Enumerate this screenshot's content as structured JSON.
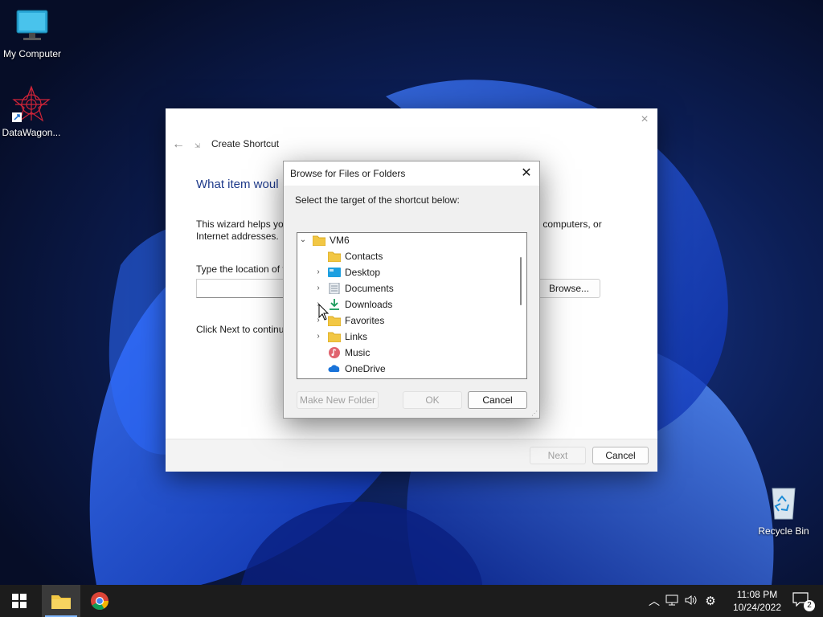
{
  "desktop": {
    "icons": [
      {
        "label": "My Computer"
      },
      {
        "label": "DataWagon..."
      },
      {
        "label": "Recycle Bin"
      }
    ]
  },
  "wizard": {
    "title": "Create Shortcut",
    "heading": "What item woul",
    "desc_line1_left": "This wizard helps you",
    "desc_line1_right": "ers, computers, or",
    "desc_line2": "Internet addresses.",
    "location_label": "Type the location of t",
    "browse_label": "Browse...",
    "next_hint": "Click Next to continu",
    "next_label": "Next",
    "cancel_label": "Cancel",
    "close_icon": "×"
  },
  "browse_dialog": {
    "title": "Browse for Files or Folders",
    "prompt": "Select the target of the shortcut below:",
    "tree": [
      {
        "label": "VM6",
        "icon": "folder-icon",
        "expander": "expanded"
      },
      {
        "label": "Contacts",
        "icon": "folder-icon",
        "expander": "none"
      },
      {
        "label": "Desktop",
        "icon": "desktop-folder-icon",
        "expander": "collapsed"
      },
      {
        "label": "Documents",
        "icon": "documents-icon",
        "expander": "collapsed"
      },
      {
        "label": "Downloads",
        "icon": "download-icon",
        "expander": "collapsed"
      },
      {
        "label": "Favorites",
        "icon": "folder-icon",
        "expander": "collapsed"
      },
      {
        "label": "Links",
        "icon": "folder-icon",
        "expander": "collapsed"
      },
      {
        "label": "Music",
        "icon": "music-icon",
        "expander": "none"
      },
      {
        "label": "OneDrive",
        "icon": "onedrive-icon",
        "expander": "none"
      }
    ],
    "make_new_folder_label": "Make New Folder",
    "ok_label": "OK",
    "cancel_label": "Cancel"
  },
  "taskbar": {
    "time": "11:08 PM",
    "date": "10/24/2022",
    "notification_count": "2"
  },
  "colors": {
    "accent": "#1e3a8a",
    "folder_yellow": "#f2c744",
    "taskbar": "#1c1c1c"
  }
}
